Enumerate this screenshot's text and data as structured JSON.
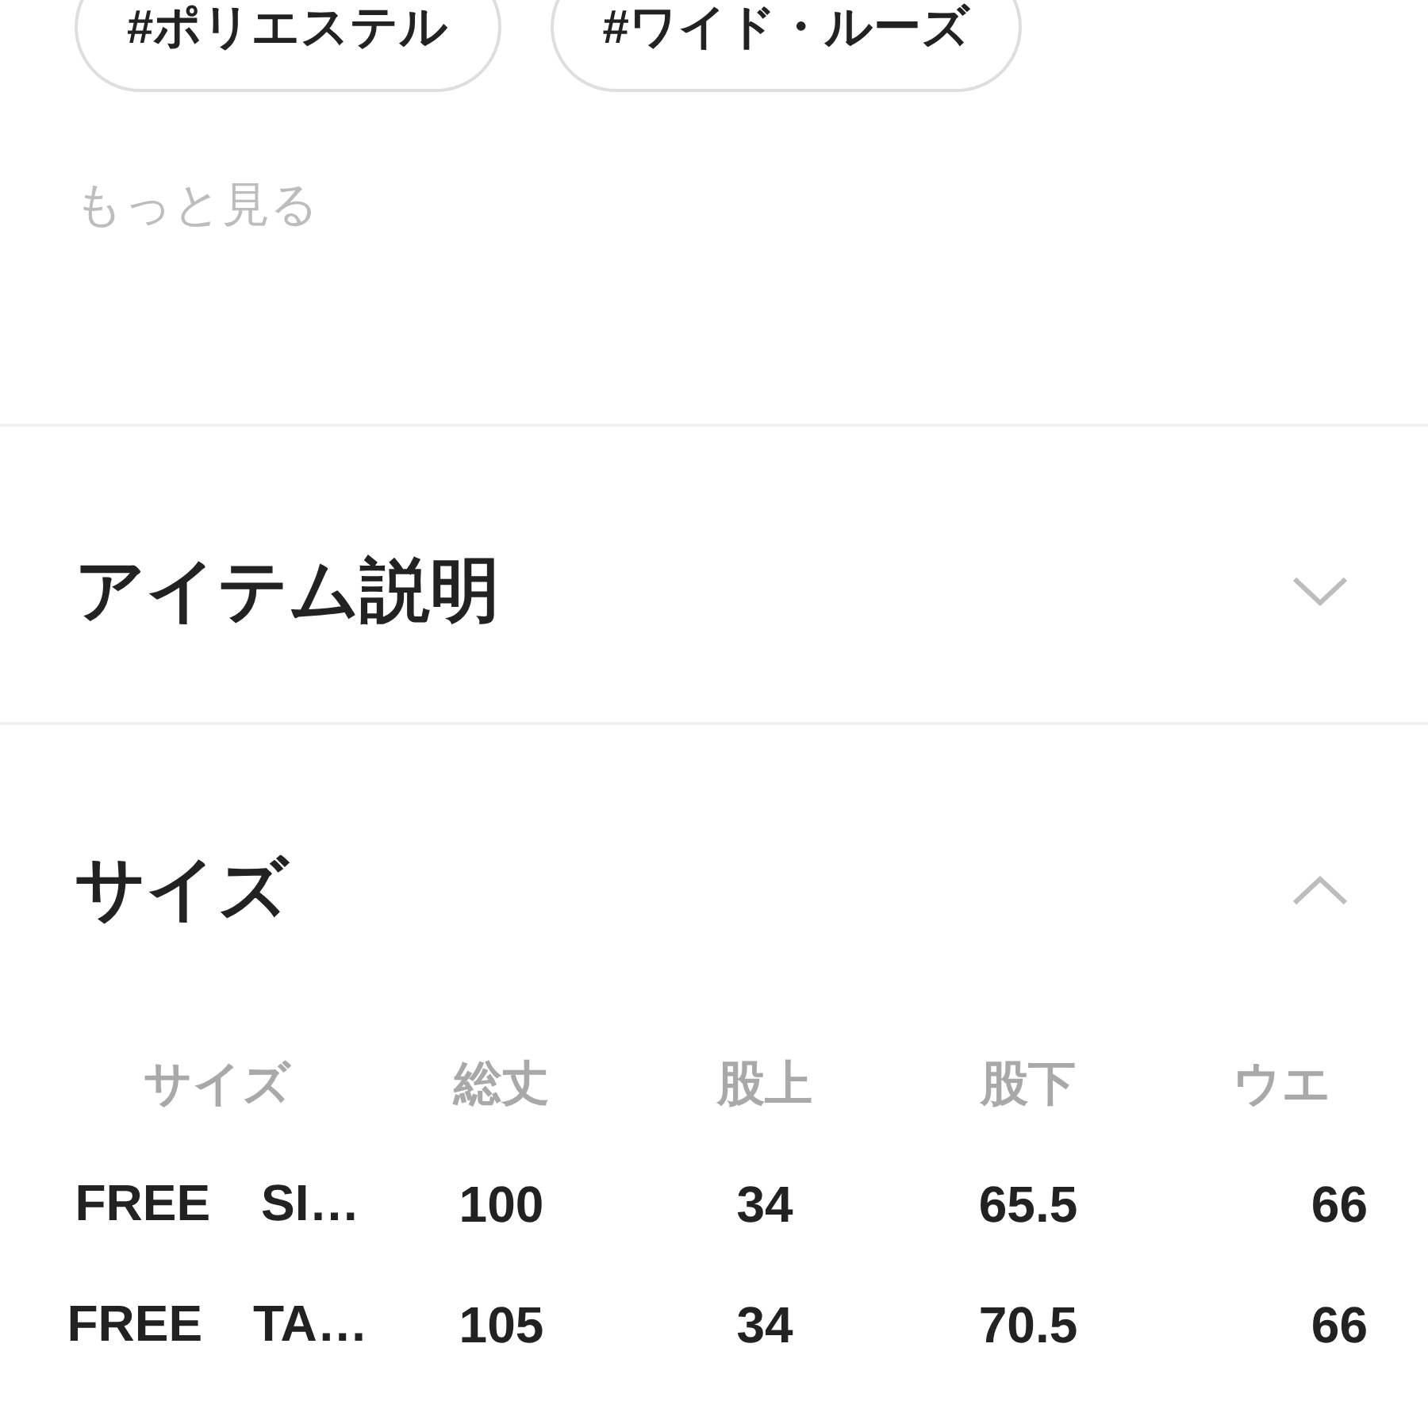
{
  "tags": [
    "#ポリエステル",
    "#ワイド・ルーズ"
  ],
  "more_link": "もっと見る",
  "sections": [
    {
      "title": "アイテム説明",
      "expanded": false
    },
    {
      "title": "サイズ",
      "expanded": true,
      "table": {
        "columns": [
          "サイズ",
          "総丈",
          "股上",
          "股下",
          "ウエ"
        ],
        "rows": [
          [
            "FREE　SI…",
            "100",
            "34",
            "65.5",
            "66"
          ],
          [
            "FREE　TA…",
            "105",
            "34",
            "70.5",
            "66"
          ]
        ]
      }
    }
  ]
}
